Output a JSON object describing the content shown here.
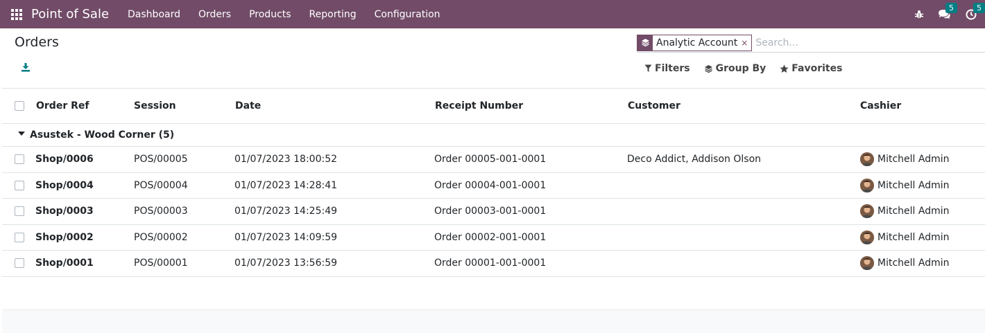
{
  "navbar": {
    "app_name": "Point of Sale",
    "menu": [
      "Dashboard",
      "Orders",
      "Products",
      "Reporting",
      "Configuration"
    ],
    "messages_badge": "5",
    "activities_badge": "5",
    "icons": [
      "apps-grid-icon",
      "bug-icon",
      "chat-icon",
      "clock-icon"
    ],
    "colors": {
      "navbar_bg": "#714b67",
      "badge_bg": "#017e84"
    }
  },
  "control_panel": {
    "title": "Orders",
    "search": {
      "facet_value": "Analytic Account",
      "facet_remove": "×",
      "placeholder": "Search..."
    },
    "filters_label": "Filters",
    "group_by_label": "Group By",
    "favorites_label": "Favorites"
  },
  "table": {
    "columns": [
      "Order Ref",
      "Session",
      "Date",
      "Receipt Number",
      "Customer",
      "Cashier"
    ],
    "group": {
      "label": "Asustek - Wood Corner (5)"
    },
    "rows": [
      {
        "ref": "Shop/0006",
        "session": "POS/00005",
        "date": "01/07/2023 18:00:52",
        "receipt": "Order 00005-001-0001",
        "customer": "Deco Addict, Addison Olson",
        "cashier": "Mitchell Admin"
      },
      {
        "ref": "Shop/0004",
        "session": "POS/00004",
        "date": "01/07/2023 14:28:41",
        "receipt": "Order 00004-001-0001",
        "customer": "",
        "cashier": "Mitchell Admin"
      },
      {
        "ref": "Shop/0003",
        "session": "POS/00003",
        "date": "01/07/2023 14:25:49",
        "receipt": "Order 00003-001-0001",
        "customer": "",
        "cashier": "Mitchell Admin"
      },
      {
        "ref": "Shop/0002",
        "session": "POS/00002",
        "date": "01/07/2023 14:09:59",
        "receipt": "Order 00002-001-0001",
        "customer": "",
        "cashier": "Mitchell Admin"
      },
      {
        "ref": "Shop/0001",
        "session": "POS/00001",
        "date": "01/07/2023 13:56:59",
        "receipt": "Order 00001-001-0001",
        "customer": "",
        "cashier": "Mitchell Admin"
      }
    ]
  }
}
